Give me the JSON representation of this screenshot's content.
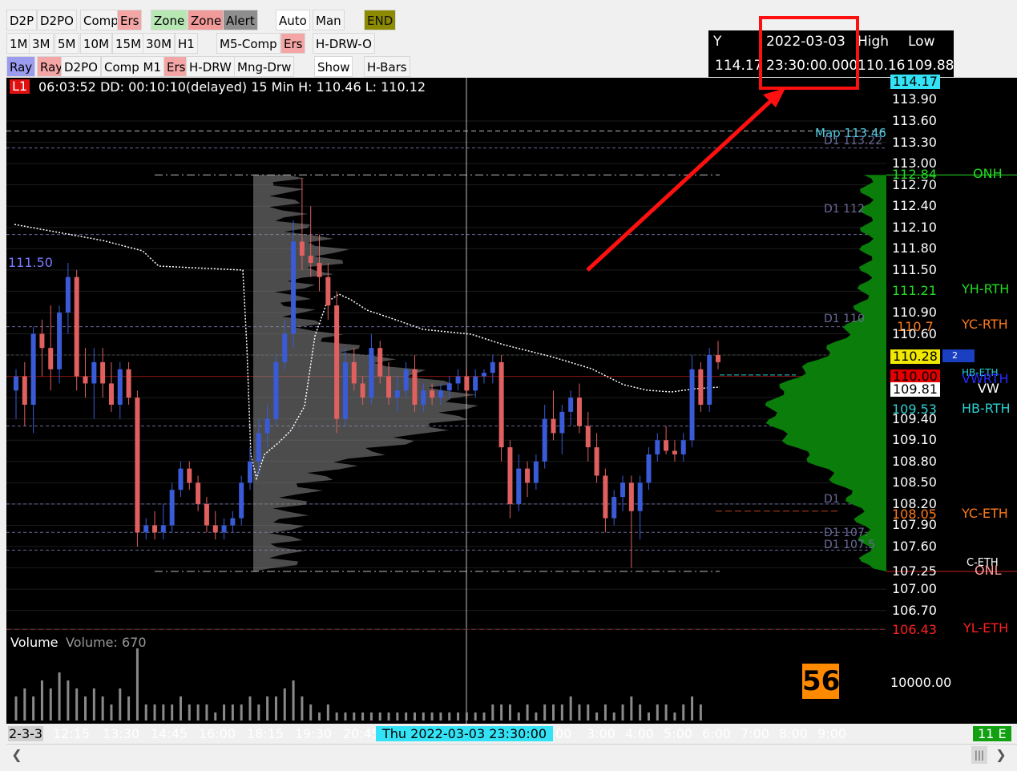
{
  "toolbar": {
    "row1": [
      {
        "label": "D2P",
        "style": "plain"
      },
      {
        "label": "D2PO",
        "style": "plain"
      },
      {
        "label": "Comp",
        "style": "plain"
      },
      {
        "label": "Ers",
        "style": "pink"
      },
      {
        "label": "Zone",
        "style": "green"
      },
      {
        "label": "Zone",
        "style": "redb"
      },
      {
        "label": "Alert",
        "style": "grayb"
      },
      {
        "label": "Auto",
        "style": "white"
      },
      {
        "label": "Man",
        "style": "plain"
      },
      {
        "label": "END",
        "style": "olive"
      }
    ],
    "row2": [
      {
        "label": "1M"
      },
      {
        "label": "3M"
      },
      {
        "label": "5M"
      },
      {
        "label": "10M"
      },
      {
        "label": "15M"
      },
      {
        "label": "30M"
      },
      {
        "label": "H1"
      },
      {
        "label": "M5-Comp"
      },
      {
        "label": "Ers"
      },
      {
        "label": "H-DRW-O"
      }
    ],
    "row3": [
      {
        "label": "Ray"
      },
      {
        "label": "Ray"
      },
      {
        "label": "D2PO"
      },
      {
        "label": "Comp M1"
      },
      {
        "label": "Ers"
      },
      {
        "label": "H-DRW"
      },
      {
        "label": "Mng-Drw"
      },
      {
        "label": "Show"
      },
      {
        "label": "H-Bars"
      }
    ]
  },
  "info_table": {
    "headers": [
      "Y",
      "2022-03-03",
      "High",
      "Low"
    ],
    "values": [
      "114.17",
      "23:30:00.000",
      "110.16",
      "109.88"
    ]
  },
  "chart_header": {
    "badge": "L1",
    "text": "06:03:52 DD: 00:10:10(delayed) 15 Min  H: 110.46  L: 110.12"
  },
  "left_label": "111.50",
  "map_label": "Map  113.46",
  "d1_labels": [
    "D1  113.22",
    "D1  112",
    "D1  110",
    "D1",
    "D1  107.",
    "D1  107.5"
  ],
  "price_axis": [
    "114.17",
    "113.90",
    "113.60",
    "113.30",
    "113.00",
    "112.84",
    "112.70",
    "112.40",
    "112.10",
    "111.80",
    "111.50",
    "111.21",
    "110.90",
    "110.7",
    "110.60",
    "110.28",
    "110.00",
    "109.81",
    "109.53",
    "109.40",
    "109.10",
    "108.80",
    "108.50",
    "108.20",
    "108.05",
    "107.90",
    "107.60",
    "107.25",
    "107.00",
    "106.70",
    "106.43"
  ],
  "side_labels": {
    "onh": "ONH",
    "yh_rth": "YH-RTH",
    "yc_rth": "YC-RTH",
    "hb_rth": "HB-RTH",
    "vw": "VW",
    "vwrth": "VWRTH",
    "hb_eth": "HB-ETH",
    "yc_eth": "YC-ETH",
    "c_eth": "C-ETH",
    "onl": "ONL",
    "yl_eth": "YL-ETH"
  },
  "marker_small": "2",
  "volume": {
    "title": "Volume",
    "value_text": "Volume: 670",
    "scale": "10000.00",
    "counter": "56"
  },
  "time_axis": {
    "left_stub": "2-3-3",
    "labels": [
      "12:15",
      "13:30",
      "14:45",
      "16:00",
      "18:15",
      "19:30",
      "20:45",
      "00",
      "3:00",
      "4:00",
      "5:00",
      "6:00",
      "7:00",
      "8:00",
      "9:00"
    ],
    "cursor_label": "Thu 2022-03-03  23:30:00",
    "right_badge": "11 E"
  },
  "chart_data": {
    "type": "candlestick",
    "title": "",
    "timeframe": "15 Min",
    "ylim": [
      106.3,
      114.3
    ],
    "candles": [
      {
        "o": 109.8,
        "h": 110.1,
        "l": 109.4,
        "c": 110.0
      },
      {
        "o": 110.0,
        "h": 110.2,
        "l": 109.3,
        "c": 109.6
      },
      {
        "o": 109.6,
        "h": 110.7,
        "l": 109.2,
        "c": 110.6
      },
      {
        "o": 110.6,
        "h": 110.8,
        "l": 110.0,
        "c": 110.4
      },
      {
        "o": 110.4,
        "h": 111.0,
        "l": 109.8,
        "c": 110.1
      },
      {
        "o": 110.1,
        "h": 111.0,
        "l": 109.9,
        "c": 110.9
      },
      {
        "o": 110.9,
        "h": 111.6,
        "l": 110.6,
        "c": 111.4
      },
      {
        "o": 111.4,
        "h": 111.5,
        "l": 109.8,
        "c": 110.0
      },
      {
        "o": 110.0,
        "h": 110.4,
        "l": 109.7,
        "c": 109.9
      },
      {
        "o": 109.9,
        "h": 110.4,
        "l": 109.4,
        "c": 110.2
      },
      {
        "o": 110.2,
        "h": 110.4,
        "l": 109.7,
        "c": 109.9
      },
      {
        "o": 109.9,
        "h": 110.2,
        "l": 109.5,
        "c": 109.6
      },
      {
        "o": 109.6,
        "h": 110.2,
        "l": 109.4,
        "c": 110.1
      },
      {
        "o": 110.1,
        "h": 110.2,
        "l": 109.6,
        "c": 109.7
      },
      {
        "o": 109.7,
        "h": 109.8,
        "l": 107.6,
        "c": 107.8
      },
      {
        "o": 107.8,
        "h": 108.0,
        "l": 107.7,
        "c": 107.9
      },
      {
        "o": 107.9,
        "h": 108.1,
        "l": 107.7,
        "c": 107.8
      },
      {
        "o": 107.8,
        "h": 108.2,
        "l": 107.7,
        "c": 107.9
      },
      {
        "o": 107.9,
        "h": 108.5,
        "l": 107.8,
        "c": 108.4
      },
      {
        "o": 108.4,
        "h": 108.8,
        "l": 108.3,
        "c": 108.7
      },
      {
        "o": 108.7,
        "h": 108.8,
        "l": 108.4,
        "c": 108.5
      },
      {
        "o": 108.5,
        "h": 108.6,
        "l": 108.1,
        "c": 108.2
      },
      {
        "o": 108.2,
        "h": 108.3,
        "l": 107.8,
        "c": 107.9
      },
      {
        "o": 107.9,
        "h": 108.1,
        "l": 107.7,
        "c": 107.8
      },
      {
        "o": 107.8,
        "h": 108.0,
        "l": 107.7,
        "c": 107.9
      },
      {
        "o": 107.9,
        "h": 108.1,
        "l": 107.8,
        "c": 108.0
      },
      {
        "o": 108.0,
        "h": 108.6,
        "l": 107.9,
        "c": 108.5
      },
      {
        "o": 108.5,
        "h": 109.0,
        "l": 108.4,
        "c": 108.8
      },
      {
        "o": 108.8,
        "h": 109.4,
        "l": 108.6,
        "c": 109.2
      },
      {
        "o": 109.2,
        "h": 109.6,
        "l": 109.0,
        "c": 109.4
      },
      {
        "o": 109.4,
        "h": 110.3,
        "l": 109.3,
        "c": 110.2
      },
      {
        "o": 110.2,
        "h": 110.8,
        "l": 110.1,
        "c": 110.6
      },
      {
        "o": 110.6,
        "h": 112.2,
        "l": 110.4,
        "c": 111.9
      },
      {
        "o": 111.9,
        "h": 112.8,
        "l": 111.5,
        "c": 111.7
      },
      {
        "o": 111.7,
        "h": 112.4,
        "l": 111.4,
        "c": 111.6
      },
      {
        "o": 111.6,
        "h": 112.0,
        "l": 111.2,
        "c": 111.4
      },
      {
        "o": 111.4,
        "h": 111.6,
        "l": 110.8,
        "c": 111.0
      },
      {
        "o": 111.0,
        "h": 111.2,
        "l": 109.2,
        "c": 109.4
      },
      {
        "o": 109.4,
        "h": 110.4,
        "l": 109.3,
        "c": 110.2
      },
      {
        "o": 110.2,
        "h": 110.4,
        "l": 109.8,
        "c": 109.9
      },
      {
        "o": 109.9,
        "h": 110.0,
        "l": 109.6,
        "c": 109.7
      },
      {
        "o": 109.7,
        "h": 110.6,
        "l": 109.6,
        "c": 110.4
      },
      {
        "o": 110.4,
        "h": 110.5,
        "l": 109.9,
        "c": 110.0
      },
      {
        "o": 110.0,
        "h": 110.2,
        "l": 109.6,
        "c": 109.7
      },
      {
        "o": 109.7,
        "h": 110.0,
        "l": 109.5,
        "c": 109.8
      },
      {
        "o": 109.8,
        "h": 110.2,
        "l": 109.7,
        "c": 110.1
      },
      {
        "o": 110.1,
        "h": 110.3,
        "l": 109.5,
        "c": 109.6
      },
      {
        "o": 109.6,
        "h": 109.9,
        "l": 109.5,
        "c": 109.8
      },
      {
        "o": 109.8,
        "h": 109.9,
        "l": 109.6,
        "c": 109.7
      },
      {
        "o": 109.7,
        "h": 109.9,
        "l": 109.6,
        "c": 109.8
      },
      {
        "o": 109.8,
        "h": 110.0,
        "l": 109.7,
        "c": 109.9
      },
      {
        "o": 109.9,
        "h": 110.1,
        "l": 109.8,
        "c": 110.0
      },
      {
        "o": 110.0,
        "h": 110.1,
        "l": 109.7,
        "c": 109.8
      },
      {
        "o": 109.8,
        "h": 110.1,
        "l": 109.7,
        "c": 110.0
      },
      {
        "o": 110.0,
        "h": 110.1,
        "l": 109.9,
        "c": 110.05
      },
      {
        "o": 110.05,
        "h": 110.3,
        "l": 109.9,
        "c": 110.2
      },
      {
        "o": 110.2,
        "h": 110.3,
        "l": 108.8,
        "c": 109.0
      },
      {
        "o": 109.0,
        "h": 109.1,
        "l": 108.0,
        "c": 108.2
      },
      {
        "o": 108.2,
        "h": 108.9,
        "l": 108.1,
        "c": 108.7
      },
      {
        "o": 108.7,
        "h": 108.8,
        "l": 108.3,
        "c": 108.5
      },
      {
        "o": 108.5,
        "h": 108.9,
        "l": 108.4,
        "c": 108.8
      },
      {
        "o": 108.8,
        "h": 109.6,
        "l": 108.7,
        "c": 109.4
      },
      {
        "o": 109.4,
        "h": 109.8,
        "l": 109.1,
        "c": 109.2
      },
      {
        "o": 109.2,
        "h": 109.6,
        "l": 108.9,
        "c": 109.5
      },
      {
        "o": 109.5,
        "h": 109.8,
        "l": 109.3,
        "c": 109.7
      },
      {
        "o": 109.7,
        "h": 109.9,
        "l": 109.2,
        "c": 109.3
      },
      {
        "o": 109.3,
        "h": 109.5,
        "l": 108.8,
        "c": 109.0
      },
      {
        "o": 109.0,
        "h": 109.2,
        "l": 108.5,
        "c": 108.6
      },
      {
        "o": 108.6,
        "h": 108.7,
        "l": 107.8,
        "c": 108.0
      },
      {
        "o": 108.0,
        "h": 108.4,
        "l": 107.9,
        "c": 108.3
      },
      {
        "o": 108.3,
        "h": 108.6,
        "l": 108.1,
        "c": 108.5
      },
      {
        "o": 108.5,
        "h": 108.6,
        "l": 107.3,
        "c": 108.1
      },
      {
        "o": 108.1,
        "h": 108.6,
        "l": 107.7,
        "c": 108.5
      },
      {
        "o": 108.5,
        "h": 109.0,
        "l": 108.4,
        "c": 108.9
      },
      {
        "o": 108.9,
        "h": 109.2,
        "l": 108.8,
        "c": 109.1
      },
      {
        "o": 109.1,
        "h": 109.3,
        "l": 108.9,
        "c": 108.95
      },
      {
        "o": 108.95,
        "h": 109.1,
        "l": 108.8,
        "c": 108.9
      },
      {
        "o": 108.9,
        "h": 109.2,
        "l": 108.8,
        "c": 109.1
      },
      {
        "o": 109.1,
        "h": 110.3,
        "l": 109.0,
        "c": 110.1
      },
      {
        "o": 110.1,
        "h": 110.2,
        "l": 109.5,
        "c": 109.6
      },
      {
        "o": 109.6,
        "h": 110.4,
        "l": 109.5,
        "c": 110.3
      },
      {
        "o": 110.3,
        "h": 110.5,
        "l": 110.1,
        "c": 110.2
      }
    ],
    "volume_bars": [
      3,
      4,
      3,
      5,
      4,
      6,
      5,
      4,
      3,
      4,
      3,
      2,
      4,
      3,
      9,
      2,
      2,
      2,
      2,
      3,
      2,
      2,
      2,
      1,
      2,
      2,
      2,
      3,
      2,
      3,
      3,
      4,
      5,
      3,
      2,
      1,
      2,
      1,
      1,
      1,
      1,
      1,
      1,
      1,
      1,
      1,
      1,
      1,
      1,
      1,
      1,
      1,
      1,
      1,
      1,
      2,
      2,
      2,
      1,
      2,
      1,
      2,
      2,
      2,
      3,
      2,
      2,
      1,
      2,
      1,
      2,
      3,
      2,
      1,
      2,
      2,
      1,
      2,
      3,
      2
    ],
    "levels": {
      "ONH": 112.84,
      "YH-RTH": 111.21,
      "YC-RTH": 110.7,
      "HB-RTH": 109.53,
      "VW": 109.81,
      "YC-ETH": 108.05,
      "ONL": 107.25,
      "YL-ETH": 106.43,
      "last": 110.28,
      "bid": 110.0,
      "map": 113.46
    },
    "colors": {
      "up": "#3a5bd8",
      "down": "#e06060",
      "profile": "#0a7d0a",
      "background": "#000000"
    }
  }
}
